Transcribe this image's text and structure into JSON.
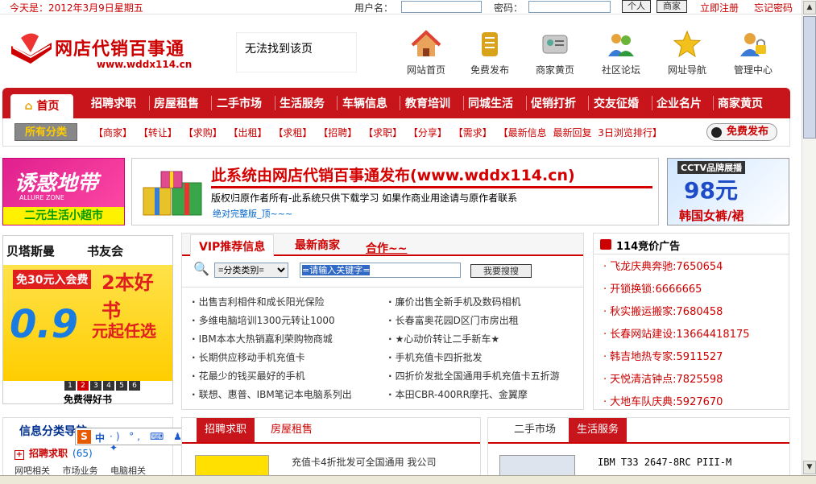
{
  "topbar": {
    "date": "今天是：2012年3月9日星期五",
    "username_label": "用户名：",
    "password_label": "密码：",
    "personal_btn": "个人",
    "merchant_btn": "商家",
    "register_link": "立即注册",
    "forgot_link": "忘记密码"
  },
  "logo": {
    "title": "网店代销百事通",
    "url": "www.wddx114.cn"
  },
  "notfound": "无法找到该页",
  "nav_icons": [
    {
      "label": "网站首页",
      "icon": "home-icon"
    },
    {
      "label": "免费发布",
      "icon": "scroll-icon"
    },
    {
      "label": "商家黄页",
      "icon": "card-icon"
    },
    {
      "label": "社区论坛",
      "icon": "users-icon"
    },
    {
      "label": "网址导航",
      "icon": "star-icon"
    },
    {
      "label": "管理中心",
      "icon": "lock-user-icon"
    }
  ],
  "menu": {
    "home": "首页",
    "items": [
      "招聘求职",
      "房屋租售",
      "二手市场",
      "生活服务",
      "车辆信息",
      "教育培训",
      "同城生活",
      "促销打折",
      "交友征婚",
      "企业名片",
      "商家黄页"
    ]
  },
  "catbar": {
    "all": "所有分类",
    "tags": [
      "【商家】",
      "【转让】",
      "【求购】",
      "【出租】",
      "【求租】",
      "【招聘】",
      "【求职】",
      "【分享】",
      "【需求】",
      "【最新信息",
      "最新回复",
      "3日浏览排行】"
    ],
    "publish": "免费发布"
  },
  "banner_left": {
    "title": "诱惑地带",
    "sub": "ALLURE     ZONE",
    "bottom": "二元生活小超市"
  },
  "banner_mid": {
    "headline": "此系统由网店代销百事通发布(www.wddx114.cn)",
    "copyright": "版权归原作者所有-此系统只供下载学习  如果作商业用途请与原作者联系",
    "edition": "绝对完整版_顶~~~"
  },
  "banner_right": {
    "tag": "CCTV品牌展播",
    "price": "98元",
    "text": "韩国女裤/裙"
  },
  "book_ad": {
    "brand_a": "贝塔斯曼",
    "brand_b": "书友会",
    "offer1": "免30元入会费",
    "offer2": "2本好书",
    "price": "0.9",
    "price_tail": "元起任选",
    "pages": [
      "1",
      "2",
      "3",
      "4",
      "5",
      "6"
    ],
    "caption": "免费得好书"
  },
  "vip": {
    "tabs": [
      "VIP推荐信息",
      "最新商家",
      "合作~~"
    ],
    "select_value": "=分类类别=",
    "keyword": "=请输入关键字=",
    "search_btn": "我要搜搜",
    "left_items": [
      "出售吉利相件和成长阳光保险",
      "多维电脑培训1300元转让1000",
      "IBM本本大热销嘉利荣购物商城",
      "长期供应移动手机充值卡",
      "花最少的钱买最好的手机",
      "联想、惠普、IBM笔记本电脑系列出"
    ],
    "right_items": [
      "廉价出售全新手机及数码相机",
      "长春富奥花园D区门市房出租",
      "★心动价转让二手新车★",
      "手机充值卡四折批发",
      "四折价发批全国通用手机充值卡五折游",
      "本田CBR-400RR摩托、金翼摩"
    ]
  },
  "ads114": {
    "title": "114竞价广告",
    "items": [
      "飞龙庆典奔驰:7650654",
      "开锁换锁:6666665",
      "秋实搬运搬家:7680458",
      "长春网站建设:13664418175",
      "韩吉地热专家:5911527",
      "天悦清洁钟点:7825598",
      "大地车队庆典:5927670"
    ]
  },
  "categories": {
    "title": "信息分类导航",
    "row1_label": "招聘求职",
    "row1_count": "(65)",
    "row2": [
      "网吧相关",
      "市场业务",
      "电脑相关"
    ]
  },
  "ime": {
    "s": "S",
    "text": "中",
    "rest": "·) °, ⌨ ♟ 👕 ✦"
  },
  "section_jobs": {
    "tabs": [
      "招聘求职",
      "房屋租售"
    ],
    "text": "充值卡4折批发可全国通用  我公司"
  },
  "section_market": {
    "tabs": [
      "二手市场",
      "生活服务"
    ],
    "text": "IBM T33 2647-8RC PIII-M"
  },
  "colors": {
    "brand_red": "#c8151b",
    "link_red": "#c00",
    "blue": "#00308f"
  }
}
